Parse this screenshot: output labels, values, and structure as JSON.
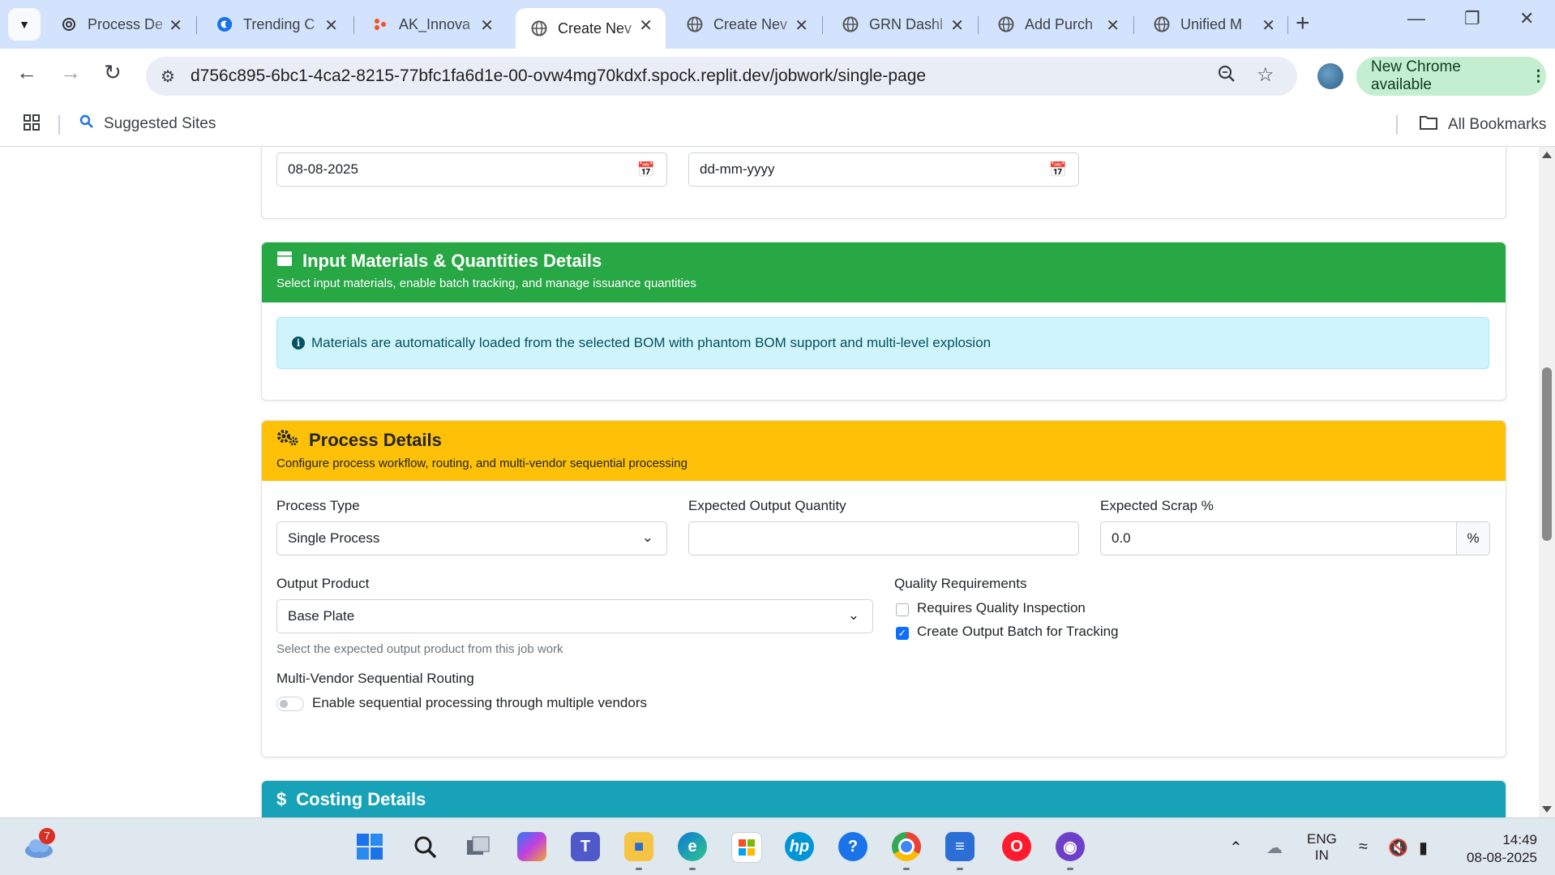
{
  "browser": {
    "tabs": [
      {
        "title": "Process De",
        "icon": "openai-icon"
      },
      {
        "title": "Trending C",
        "icon": "c-logo-icon"
      },
      {
        "title": "AK_Innova",
        "icon": "figma-like-icon"
      },
      {
        "title": "Create Nev",
        "icon": "globe-icon"
      },
      {
        "title": "Create Nev",
        "icon": "globe-icon"
      },
      {
        "title": "GRN Dashl",
        "icon": "globe-icon"
      },
      {
        "title": "Add Purch",
        "icon": "globe-icon"
      },
      {
        "title": "Unified M",
        "icon": "globe-icon"
      }
    ],
    "active_tab_index": 3,
    "url": "d756c895-6bc1-4ca2-8215-77bfc1fa6d1e-00-ovw4mg70kdxf.spock.replit.dev/jobwork/single-page",
    "update_label": "New Chrome available",
    "bookmarks": {
      "suggested": "Suggested Sites",
      "all": "All Bookmarks"
    }
  },
  "dates": {
    "date1_value": "08-08-2025",
    "date2_placeholder": "dd-mm-yyyy"
  },
  "input_materials": {
    "title": "Input Materials & Quantities Details",
    "subtitle": "Select input materials, enable batch tracking, and manage issuance quantities",
    "info": "Materials are automatically loaded from the selected BOM with phantom BOM support and multi-level explosion",
    "color": "#28a745"
  },
  "process": {
    "title": "Process Details",
    "subtitle": "Configure process workflow, routing, and multi-vendor sequential processing",
    "color": "#ffc107",
    "process_type_label": "Process Type",
    "process_type_value": "Single Process",
    "expected_output_label": "Expected Output Quantity",
    "expected_output_value": "",
    "scrap_label": "Expected Scrap %",
    "scrap_value": "0.0",
    "scrap_unit": "%",
    "output_product_label": "Output Product",
    "output_product_value": "Base Plate",
    "output_product_help": "Select the expected output product from this job work",
    "quality_label": "Quality Requirements",
    "quality_inspection_label": "Requires Quality Inspection",
    "quality_inspection_checked": false,
    "output_batch_label": "Create Output Batch for Tracking",
    "output_batch_checked": true,
    "multi_vendor_label": "Multi-Vendor Sequential Routing",
    "multi_vendor_toggle_label": "Enable sequential processing through multiple vendors",
    "multi_vendor_enabled": false
  },
  "costing": {
    "title": "Costing Details",
    "color": "#17a2b8"
  },
  "taskbar": {
    "weather_badge": "7",
    "lang_top": "ENG",
    "lang_bottom": "IN",
    "time": "14:49",
    "date": "08-08-2025"
  }
}
